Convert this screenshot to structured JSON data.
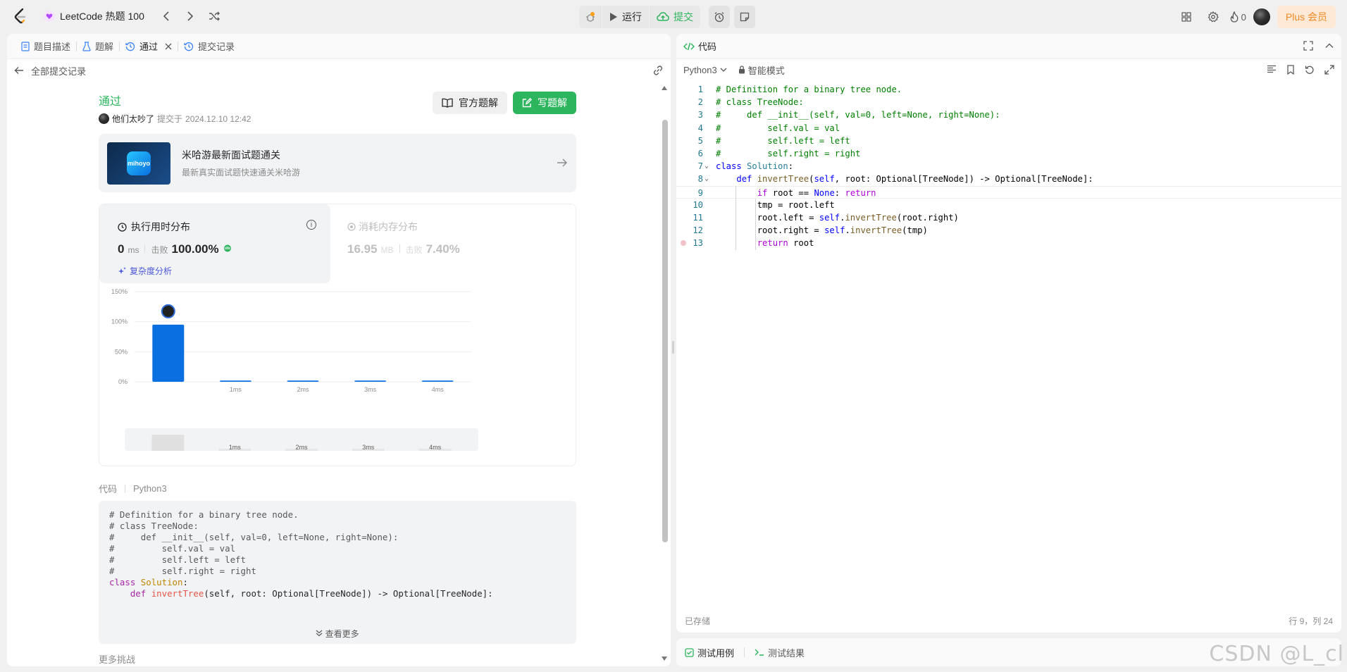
{
  "topbar": {
    "problem_list": "LeetCode 热题 100",
    "run_label": "运行",
    "submit_label": "提交",
    "streak_count": "0",
    "plus_label": "Plus 会员"
  },
  "left_tabs": [
    {
      "label": "题目描述"
    },
    {
      "label": "题解"
    },
    {
      "label": "通过"
    },
    {
      "label": "提交记录"
    }
  ],
  "back_label": "全部提交记录",
  "submission": {
    "status": "通过",
    "user": "他们太吵了",
    "submitted_prefix": "提交于",
    "submitted_at": "2024.12.10 12:42",
    "official_solution": "官方题解",
    "write_solution": "写题解"
  },
  "banner": {
    "logo_text": "mihoyo",
    "title": "米哈游最新面试题通关",
    "subtitle": "最新真实面试题快速通关米哈游"
  },
  "runtime": {
    "title": "执行用时分布",
    "value": "0",
    "unit": "ms",
    "beats_label": "击败",
    "beats": "100.00%",
    "complexity": "复杂度分析"
  },
  "memory": {
    "title": "消耗内存分布",
    "value": "16.95",
    "unit": "MB",
    "beats_label": "击败",
    "beats": "7.40%"
  },
  "chart_data": {
    "type": "bar",
    "categories": [
      "0ms",
      "1ms",
      "2ms",
      "3ms",
      "4ms"
    ],
    "x_tick_labels": [
      "",
      "1ms",
      "2ms",
      "3ms",
      "4ms"
    ],
    "values": [
      95,
      2,
      2,
      2,
      2
    ],
    "y_tick_labels": [
      "0%",
      "50%",
      "100%",
      "150%"
    ],
    "ylim": [
      0,
      150
    ],
    "grid": true,
    "color": "#0a6fe0",
    "mini_tick_labels": [
      "1ms",
      "2ms",
      "3ms",
      "4ms"
    ]
  },
  "code_section": {
    "label": "代码",
    "language": "Python3",
    "view_more": "查看更多",
    "more_challenges": "更多挑战"
  },
  "right": {
    "tab_label": "代码",
    "language": "Python3",
    "smart_mode": "智能模式",
    "saved": "已存储",
    "cursor_pos": "行 9，列 24",
    "testcase_tab": "测试用例",
    "result_tab": "测试结果"
  },
  "code_lines": [
    "# Definition for a binary tree node.",
    "# class TreeNode:",
    "#     def __init__(self, val=0, left=None, right=None):",
    "#         self.val = val",
    "#         self.left = left",
    "#         self.right = right",
    "class Solution:",
    "    def invertTree(self, root: Optional[TreeNode]) -> Optional[TreeNode]:",
    "        if root == None: return",
    "        tmp = root.left",
    "        root.left = self.invertTree(root.right)",
    "        root.right = self.invertTree(tmp)",
    "        return root"
  ],
  "watermark": "CSDN @L_cl"
}
